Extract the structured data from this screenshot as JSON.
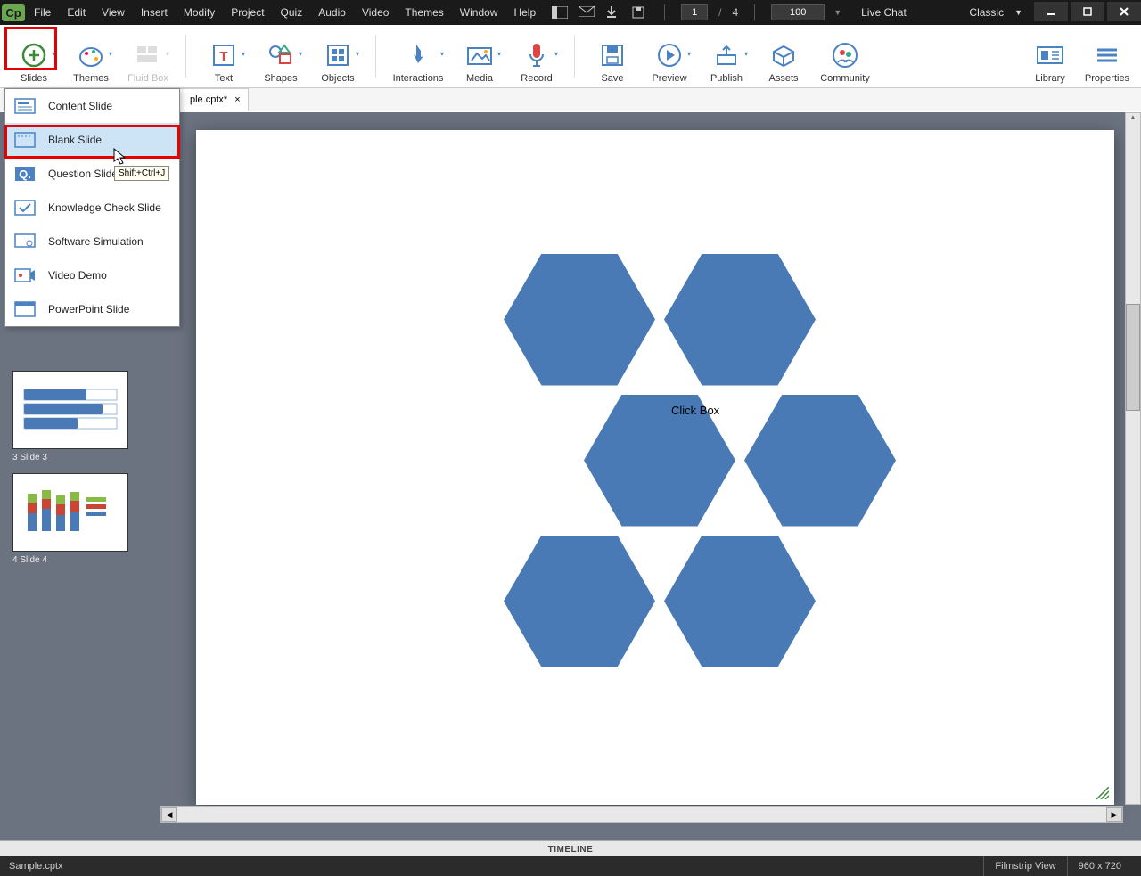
{
  "title_menus": [
    "File",
    "Edit",
    "View",
    "Insert",
    "Modify",
    "Project",
    "Quiz",
    "Audio",
    "Video",
    "Themes",
    "Window",
    "Help"
  ],
  "page": {
    "current": "1",
    "sep": "/",
    "total": "4"
  },
  "zoom": "100",
  "live_chat": "Live Chat",
  "workspace": "Classic",
  "ribbon": {
    "slides": "Slides",
    "themes": "Themes",
    "fluidbox": "Fluid Box",
    "text": "Text",
    "shapes": "Shapes",
    "objects": "Objects",
    "interactions": "Interactions",
    "media": "Media",
    "record": "Record",
    "save": "Save",
    "preview": "Preview",
    "publish": "Publish",
    "assets": "Assets",
    "community": "Community",
    "library": "Library",
    "properties": "Properties"
  },
  "doctab": {
    "name": "ple.cptx*",
    "close": "×"
  },
  "slides_menu": [
    {
      "label": "Content Slide"
    },
    {
      "label": "Blank Slide"
    },
    {
      "label": "Question Slide"
    },
    {
      "label": "Knowledge Check Slide"
    },
    {
      "label": "Software Simulation"
    },
    {
      "label": "Video Demo"
    },
    {
      "label": "PowerPoint Slide"
    }
  ],
  "shortcut_tip": "Shift+Ctrl+J",
  "thumbs": [
    {
      "label": "3 Slide 3"
    },
    {
      "label": "4 Slide 4"
    }
  ],
  "canvas": {
    "clickbox": "Click Box"
  },
  "timeline": "TIMELINE",
  "status": {
    "file": "Sample.cptx",
    "view": "Filmstrip View",
    "dims": "960 x 720"
  }
}
